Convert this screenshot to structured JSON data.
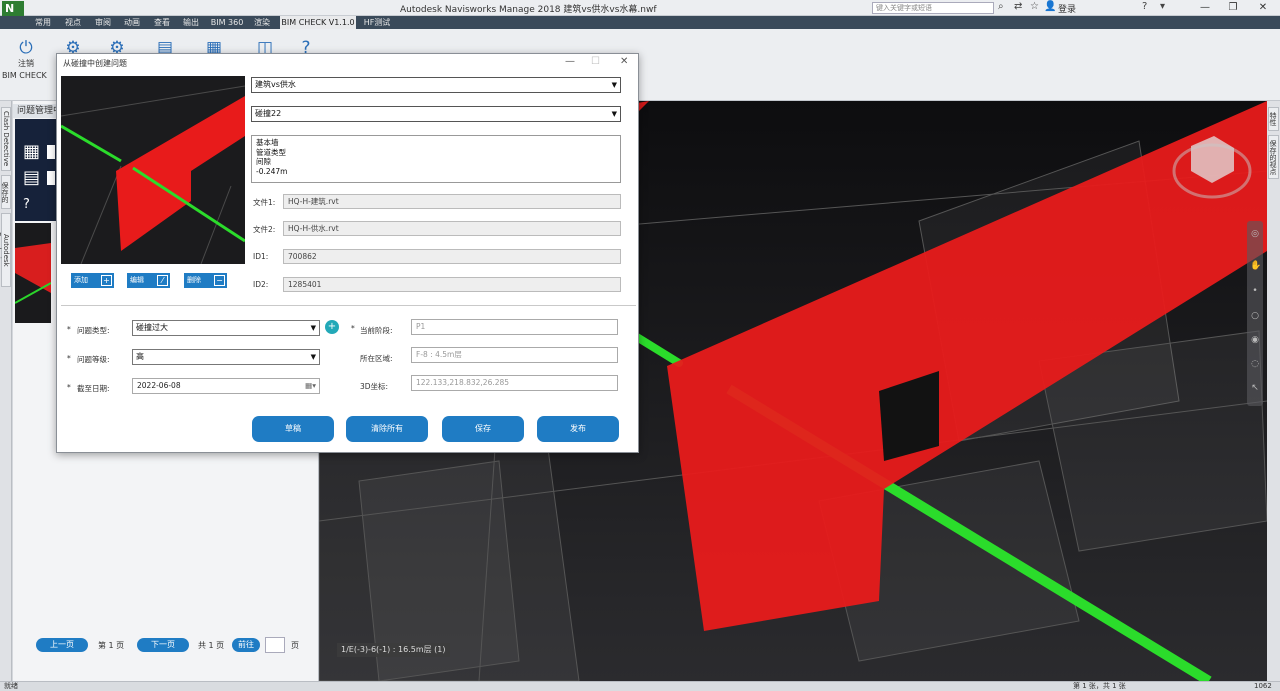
{
  "titlebar": {
    "logo": "N",
    "title": "Autodesk Navisworks Manage 2018   建筑vs供水vs水幕.nwf",
    "search_placeholder": "键入关键字或短语",
    "login": "登录",
    "help": "?"
  },
  "menu": {
    "tabs": [
      "常用",
      "视点",
      "审阅",
      "动画",
      "查看",
      "输出",
      "BIM 360",
      "渲染",
      "BIM CHECK V1.1.0",
      "HF测试"
    ],
    "active": "BIM CHECK V1.1.0"
  },
  "ribbon": {
    "logout_label": "注销",
    "group_label": "BIM CHECK"
  },
  "left_vtabs": [
    "Clash Detective",
    "保存的视点",
    "Autodesk Rendering"
  ],
  "right_vtabs": [
    "特性",
    "保存的视点"
  ],
  "left_panel": {
    "header": "问题管理中",
    "pager": {
      "prev": "上一页",
      "page": "第 1 页",
      "next": "下一页",
      "total": "共 1 页",
      "goto": "前往",
      "page_suffix": "页"
    }
  },
  "viewport": {
    "label": "1/E(-3)-6(-1) : 16.5m层 (1)"
  },
  "statusbar": {
    "ready": "就绪",
    "pages": "第 1 张，共 1 张",
    "memory": "1062 MB"
  },
  "dialog": {
    "title": "从碰撞中创建问题",
    "clash_test": "建筑vs供水",
    "clash_item": "碰撞22",
    "info_lines": [
      "基本墙",
      "管道类型",
      "间隙",
      "-0.247m"
    ],
    "file1_label": "文件1:",
    "file1_value": "HQ-H-建筑.rvt",
    "file2_label": "文件2:",
    "file2_value": "HQ-H-供水.rvt",
    "id1_label": "ID1:",
    "id1_value": "700862",
    "id2_label": "ID2:",
    "id2_value": "1285401",
    "preview_buttons": {
      "add": "添加",
      "edit": "编辑",
      "delete": "删除"
    },
    "form": {
      "issue_type_label": "问题类型:",
      "issue_type_value": "碰撞过大",
      "issue_level_label": "问题等级:",
      "issue_level_value": "高",
      "due_date_label": "截至日期:",
      "due_date_value": "2022-06-08",
      "stage_label": "当前阶段:",
      "stage_value": "P1",
      "area_label": "所在区域:",
      "area_value": "F-8 : 4.5m层",
      "coord_label": "3D坐标:",
      "coord_value": "122.133,218.832,26.285",
      "required_mark": "*"
    },
    "actions": [
      "草稿",
      "清除所有",
      "保存",
      "发布"
    ]
  },
  "colors": {
    "accent": "#1f7cc4",
    "clash_red": "#e81b1b",
    "pipe_green": "#2bdc2b",
    "menubar": "#3a4a5a"
  }
}
